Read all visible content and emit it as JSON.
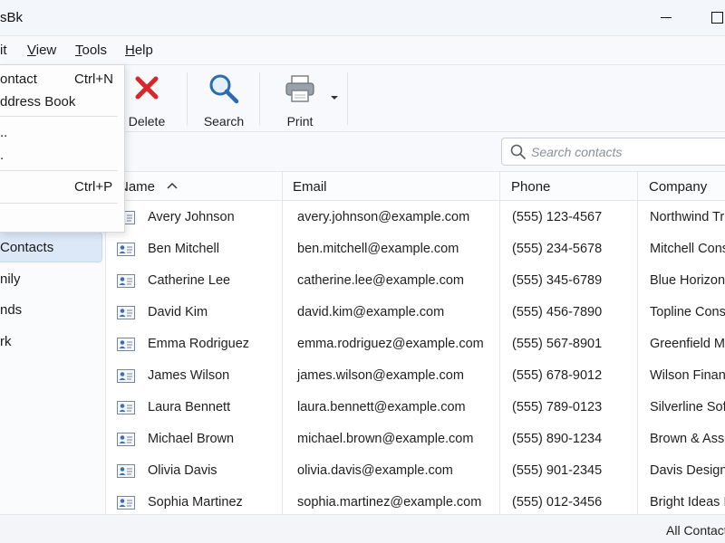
{
  "window": {
    "title": "sBk"
  },
  "menubar": {
    "items": [
      {
        "label": "it"
      },
      {
        "label": "View",
        "mnemonic": "V",
        "rest": "iew"
      },
      {
        "label": "Tools",
        "mnemonic": "T",
        "rest": "ools"
      },
      {
        "label": "Help",
        "mnemonic": "H",
        "rest": "elp"
      }
    ]
  },
  "file_menu": {
    "items": [
      {
        "label": "ontact",
        "shortcut": "Ctrl+N"
      },
      {
        "label": "ddress Book",
        "shortcut": ""
      },
      {
        "label": "..",
        "shortcut": ""
      },
      {
        "label": ".",
        "shortcut": ""
      },
      {
        "label": "",
        "shortcut": "Ctrl+P"
      }
    ]
  },
  "toolbar": {
    "delete_label": "Delete",
    "search_label": "Search",
    "print_label": "Print"
  },
  "search": {
    "placeholder": "Search contacts",
    "value": ""
  },
  "sidebar": {
    "items": [
      {
        "label": "Contacts",
        "selected": true
      },
      {
        "label": "nily",
        "selected": false
      },
      {
        "label": "nds",
        "selected": false
      },
      {
        "label": "rk",
        "selected": false
      }
    ]
  },
  "table": {
    "columns": [
      "Name",
      "Email",
      "Phone",
      "Company"
    ],
    "sort_column": "Name",
    "sort_direction": "ascending",
    "rows": [
      {
        "name": "Avery Johnson",
        "email": "avery.johnson@example.com",
        "phone": "(555) 123-4567",
        "company": "Northwind Tra"
      },
      {
        "name": "Ben Mitchell",
        "email": "ben.mitchell@example.com",
        "phone": "(555) 234-5678",
        "company": "Mitchell Consu"
      },
      {
        "name": "Catherine Lee",
        "email": "catherine.lee@example.com",
        "phone": "(555) 345-6789",
        "company": "Blue Horizon"
      },
      {
        "name": "David Kim",
        "email": "david.kim@example.com",
        "phone": "(555) 456-7890",
        "company": "Topline Constr"
      },
      {
        "name": "Emma Rodriguez",
        "email": "emma.rodriguez@example.com",
        "phone": "(555) 567-8901",
        "company": "Greenfield Ma"
      },
      {
        "name": "James Wilson",
        "email": "james.wilson@example.com",
        "phone": "(555) 678-9012",
        "company": "Wilson Financ"
      },
      {
        "name": "Laura Bennett",
        "email": "laura.bennett@example.com",
        "phone": "(555) 789-0123",
        "company": "Silverline Softw"
      },
      {
        "name": "Michael Brown",
        "email": "michael.brown@example.com",
        "phone": "(555) 890-1234",
        "company": "Brown & Asso"
      },
      {
        "name": "Olivia Davis",
        "email": "olivia.davis@example.com",
        "phone": "(555) 901-2345",
        "company": "Davis Design"
      },
      {
        "name": "Sophia Martinez",
        "email": "sophia.martinez@example.com",
        "phone": "(555) 012-3456",
        "company": "Bright Ideas In"
      }
    ]
  },
  "status": {
    "text": "All Contacts"
  },
  "colors": {
    "accent": "#2b6cb0",
    "selection": "#dce8f8",
    "delete_red": "#d9262b"
  },
  "icons": {
    "delete": "x-icon",
    "search": "magnifier-icon",
    "print": "printer-icon",
    "contact": "contact-card-icon"
  }
}
